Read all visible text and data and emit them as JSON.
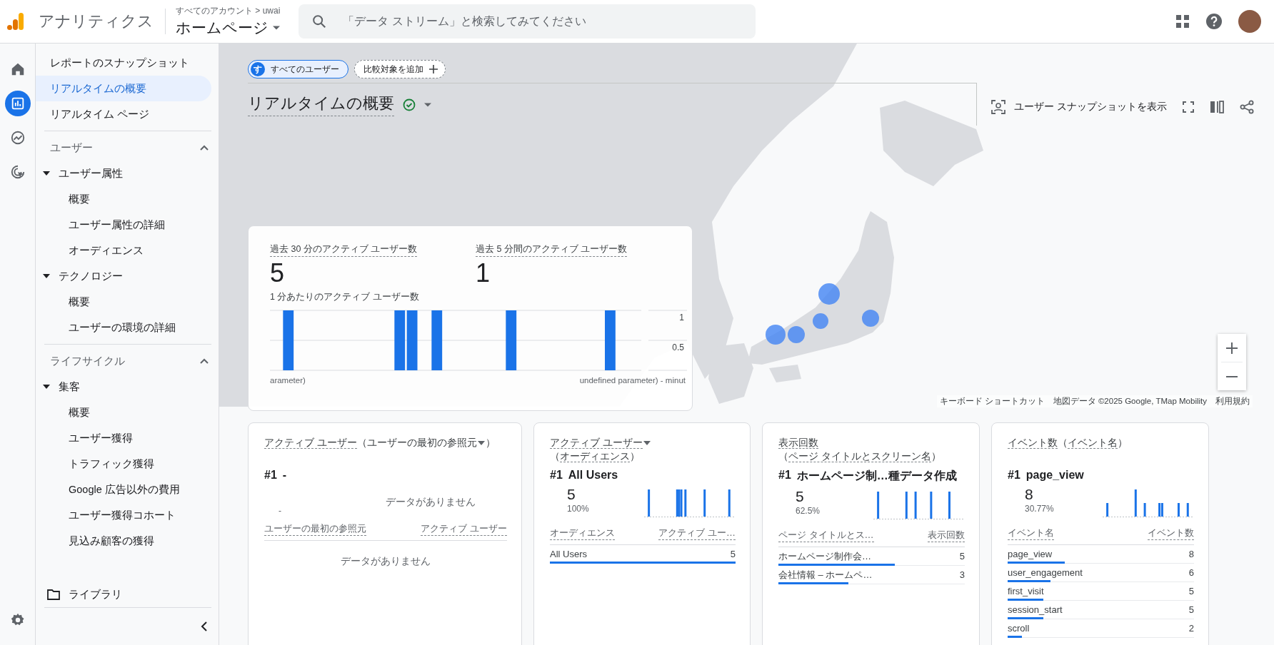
{
  "header": {
    "product_name": "アナリティクス",
    "breadcrumb": "すべてのアカウント > uwai",
    "property": "ホームページ",
    "search_placeholder": "「データ ストリーム」と検索してみてください"
  },
  "nav_rail": [
    {
      "kind": "home",
      "selected": false
    },
    {
      "kind": "reports",
      "selected": true
    },
    {
      "kind": "explore",
      "selected": false
    },
    {
      "kind": "advertising",
      "selected": false
    }
  ],
  "sidebar": {
    "items": [
      {
        "label": "レポートのスナップショット",
        "selected": false
      },
      {
        "label": "リアルタイムの概要",
        "selected": true
      },
      {
        "label": "リアルタイム ページ",
        "selected": false
      }
    ],
    "sections": [
      {
        "title": "ユーザー",
        "expanded": true,
        "groups": [
          {
            "label": "ユーザー属性",
            "expanded": true,
            "children": [
              {
                "label": "概要",
                "selected": false
              },
              {
                "label": "ユーザー属性の詳細",
                "selected": false
              },
              {
                "label": "オーディエンス",
                "selected": false
              }
            ]
          },
          {
            "label": "テクノロジー",
            "expanded": true,
            "children": [
              {
                "label": "概要",
                "selected": false
              },
              {
                "label": "ユーザーの環境の詳細",
                "selected": false
              }
            ]
          }
        ]
      },
      {
        "title": "ライフサイクル",
        "expanded": true,
        "groups": [
          {
            "label": "集客",
            "expanded": true,
            "children": [
              {
                "label": "概要",
                "selected": false
              },
              {
                "label": "ユーザー獲得",
                "selected": false
              },
              {
                "label": "トラフィック獲得",
                "selected": false
              },
              {
                "label": "Google 広告以外の費用",
                "selected": false
              },
              {
                "label": "ユーザー獲得コホート",
                "selected": false
              },
              {
                "label": "見込み顧客の獲得",
                "selected": false
              }
            ]
          }
        ]
      }
    ],
    "library": "ライブラリ"
  },
  "main": {
    "comparison_chips": [
      {
        "kind": "segment",
        "avatar": "す",
        "label": "すべてのユーザー"
      },
      {
        "kind": "add",
        "label": "比較対象を追加"
      }
    ],
    "title": "リアルタイムの概要",
    "toolbar": {
      "snapshot_button": "ユーザー スナップショットを表示"
    },
    "map_attribution": [
      "キーボード ショートカット",
      "地図データ ©2025 Google, TMap Mobility",
      "利用規約"
    ],
    "summary": {
      "metrics": [
        {
          "label": "過去 30 分のアクティブ ユーザー数",
          "value": "5"
        },
        {
          "label": "過去 5 分間のアクティブ ユーザー数",
          "value": "1"
        }
      ],
      "chart_data": {
        "type": "bar",
        "title": "1 分あたりのアクティブ ユーザー数",
        "values": [
          0,
          1,
          0,
          0,
          0,
          0,
          0,
          0,
          0,
          0,
          1,
          1,
          0,
          1,
          0,
          0,
          0,
          0,
          0,
          1,
          0,
          0,
          0,
          0,
          0,
          0,
          0,
          1,
          0,
          0
        ],
        "ylim": [
          0,
          1
        ],
        "yticks": [
          0.5,
          1
        ]
      },
      "axis_label_fragments": [
        "arameter)",
        "undefined parameter) - minut"
      ]
    },
    "cards": [
      {
        "title": [
          {
            "kind": "term",
            "text": "アクティブ ユーザー"
          },
          {
            "kind": "text",
            "text": "（ユーザーの最初の参照元"
          },
          {
            "kind": "dropdown"
          },
          {
            "kind": "text",
            "text": "）"
          }
        ],
        "rank": "#1",
        "top_item": "-",
        "empty_marker": "-",
        "empty_text": "データがありません",
        "columns": [
          "ユーザーの最初の参照元",
          "アクティブ ユーザー"
        ],
        "table_empty_text": "データがありません"
      },
      {
        "title": [
          {
            "kind": "term",
            "text": "アクティブ ユーザー"
          },
          {
            "kind": "dropdown"
          },
          {
            "kind": "text",
            "text": "（"
          },
          {
            "kind": "term",
            "text": "オーディエンス"
          },
          {
            "kind": "text",
            "text": "）"
          }
        ],
        "rank": "#1",
        "top_item": "All Users",
        "value": "5",
        "share": "100%",
        "columns": [
          "オーディエンス",
          "アクティブ ユー…"
        ],
        "rows": [
          {
            "name": "All Users",
            "value": "5",
            "level": 1
          }
        ]
      },
      {
        "title": [
          {
            "kind": "term",
            "text": "表示回数"
          },
          {
            "kind": "text",
            "text": "（"
          },
          {
            "kind": "term",
            "text": "ページ タイトルとスクリーン名"
          },
          {
            "kind": "text",
            "text": "）"
          }
        ],
        "rank": "#1",
        "top_item": "ホームページ制…種データ作成",
        "value": "5",
        "share": "62.5%",
        "columns": [
          "ページ タイトルとス…",
          "表示回数"
        ],
        "rows": [
          {
            "name": "ホームページ制作会…",
            "value": "5",
            "level": 0.625
          },
          {
            "name": "会社情報 – ホームペ…",
            "value": "3",
            "level": 0.375
          }
        ]
      },
      {
        "title": [
          {
            "kind": "term",
            "text": "イベント数"
          },
          {
            "kind": "text",
            "text": "（"
          },
          {
            "kind": "term",
            "text": "イベント名"
          },
          {
            "kind": "text",
            "text": "）"
          }
        ],
        "rank": "#1",
        "top_item": "page_view",
        "value": "8",
        "share": "30.77%",
        "columns": [
          "イベント名",
          "イベント数"
        ],
        "rows": [
          {
            "name": "page_view",
            "value": "8",
            "level": 0.3077
          },
          {
            "name": "user_engagement",
            "value": "6",
            "level": 0.2308
          },
          {
            "name": "first_visit",
            "value": "5",
            "level": 0.1923
          },
          {
            "name": "session_start",
            "value": "5",
            "level": 0.1923
          },
          {
            "name": "scroll",
            "value": "2",
            "level": 0.0769
          }
        ]
      }
    ]
  }
}
